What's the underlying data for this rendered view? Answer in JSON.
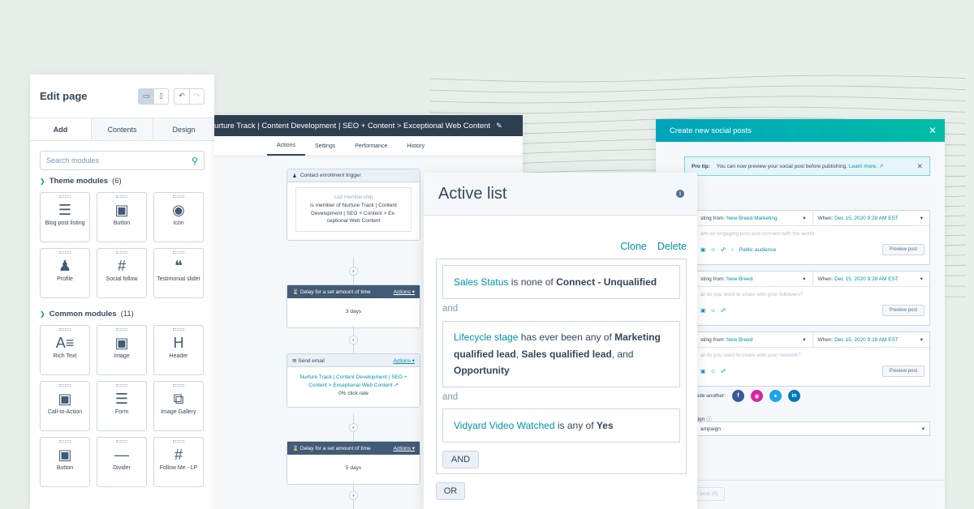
{
  "edit_page": {
    "title": "Edit page",
    "tabs": [
      "Add",
      "Contents",
      "Design"
    ],
    "search_placeholder": "Search modules",
    "theme_group": {
      "name": "Theme modules",
      "count": "(6)"
    },
    "theme_modules": [
      {
        "label": "Blog post listing",
        "icon": "list-icon"
      },
      {
        "label": "Button",
        "icon": "button-icon"
      },
      {
        "label": "Icon",
        "icon": "target-icon"
      },
      {
        "label": "Profile",
        "icon": "person-icon"
      },
      {
        "label": "Social follow",
        "icon": "hashtag-icon"
      },
      {
        "label": "Testimonial slider",
        "icon": "quote-icon"
      }
    ],
    "common_group": {
      "name": "Common modules",
      "count": "(11)"
    },
    "common_modules": [
      {
        "label": "Rich Text",
        "icon": "rich-text-icon"
      },
      {
        "label": "Image",
        "icon": "image-icon"
      },
      {
        "label": "Header",
        "icon": "header-icon"
      },
      {
        "label": "Call-to-Action",
        "icon": "cta-icon"
      },
      {
        "label": "Form",
        "icon": "form-icon"
      },
      {
        "label": "Image Gallery",
        "icon": "gallery-icon"
      },
      {
        "label": "Button",
        "icon": "button-icon"
      },
      {
        "label": "Divider",
        "icon": "divider-icon"
      },
      {
        "label": "Follow Me - LP",
        "icon": "hashtag-icon"
      }
    ]
  },
  "workflow": {
    "title": "urture Track | Content Development | SEO + Content > Exceptional Web Content",
    "tabs": [
      "Actions",
      "Settings",
      "Performance",
      "History"
    ],
    "trigger": {
      "header": "Contact enrollment trigger",
      "label": "List membership",
      "text": "is member of Nurture Track | Content Development | SEO + Content > Ex-ceptional Web Content"
    },
    "actions_label": "Actions",
    "delay1": {
      "header": "Delay for a set amount of time",
      "value": "3 days"
    },
    "email": {
      "header": "Send email",
      "link": "Nurture Track | Content Development | SEO + Content > Exceptional Web Content",
      "rate": "0% click rate"
    },
    "delay2": {
      "header": "Delay for a set amount of time",
      "value": "5 days"
    }
  },
  "social": {
    "header": "Create new social posts",
    "tip_label": "Pro tip:",
    "tip_text": "You can now preview your social post before publishing.",
    "tip_link": "Learn more.",
    "posts": [
      {
        "from_label": "sting from:",
        "from": "New Breed Marketing",
        "when_label": "When:",
        "when": "Dec 15, 2020 9:28 AM EST",
        "placeholder": "are an engaging post and connect with the world.",
        "audience": "Public audience",
        "preview": "Preview post"
      },
      {
        "from_label": "sting from:",
        "from": "New Breed",
        "when_label": "When:",
        "when": "Dec 15, 2020 9:28 AM EST",
        "placeholder": "at do you want to share with your followers?",
        "audience": "",
        "preview": "Preview post"
      },
      {
        "from_label": "sting from:",
        "from": "New Breed",
        "when_label": "When:",
        "when": "Dec 15, 2020 9:28 AM EST",
        "placeholder": "at do you want to share with your network?",
        "audience": "",
        "preview": "Preview post"
      }
    ],
    "schedule_label": "dule another:",
    "campaign_label": "aign",
    "campaign_value": "ampaign",
    "footer_btn": "e post (0)",
    "colors": {
      "facebook": "#3b5998",
      "instagram": "#d6249f",
      "twitter": "#1da1f2",
      "linkedin": "#0077b5"
    }
  },
  "active_list": {
    "title": "Active list",
    "clone": "Clone",
    "delete": "Delete",
    "filter1": {
      "prop": "Sales Status",
      "op": " is none of ",
      "val": "Connect - Unqualified"
    },
    "and1": "and",
    "filter2": {
      "prop": "Lifecycle stage",
      "op": " has ever been any of ",
      "v1": "Marketing qualified lead",
      "sep1": ", ",
      "v2": "Sales qualified lead",
      "sep2": ", and ",
      "v3": "Opportunity"
    },
    "and2": "and",
    "filter3": {
      "prop": "Vidyard Video Watched",
      "op": " is any of ",
      "val": "Yes"
    },
    "and_btn": "AND",
    "or_btn": "OR"
  }
}
